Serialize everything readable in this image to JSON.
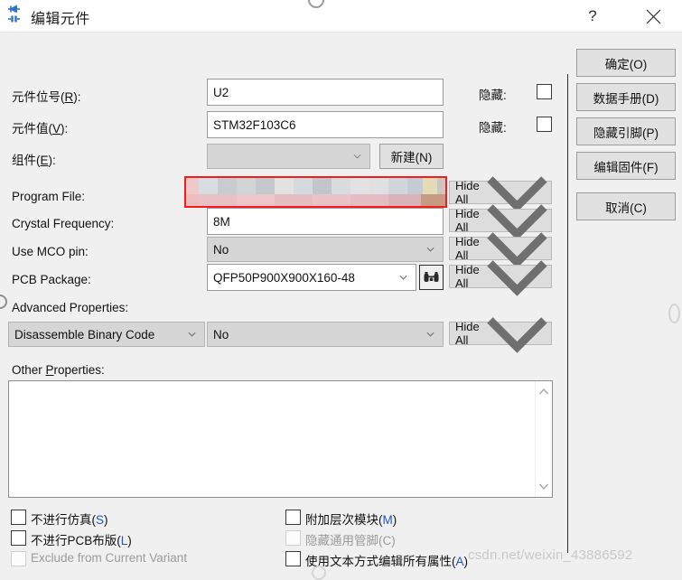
{
  "window": {
    "title": "编辑元件",
    "icon": "component-icon",
    "help_label": "?",
    "close_label": "✕"
  },
  "form": {
    "rows": [
      {
        "label_html": "元件位号(<u>R</u>):",
        "value": "U2",
        "kind": "text"
      },
      {
        "label_html": "元件值(<u>V</u>):",
        "value": "STM32F103C6",
        "kind": "text"
      },
      {
        "label_html": "组件(<u>E</u>):",
        "value": "",
        "kind": "combo-disabled"
      },
      {
        "label_html": "Program File:",
        "value": "",
        "kind": "redacted"
      },
      {
        "label_html": "Crystal Frequency:",
        "value": "8M",
        "kind": "text"
      },
      {
        "label_html": "Use MCO pin:",
        "value": "No",
        "kind": "combo"
      },
      {
        "label_html": "PCB Package:",
        "value": "QFP50P900X900X160-48",
        "kind": "combo-browse"
      }
    ],
    "new_button": "新建(N)",
    "browse_icon": "binoculars-icon",
    "hidden_label": "隐藏:",
    "hide_all_label": "Hide All",
    "hide_all_count": 5
  },
  "advanced": {
    "label": "Advanced Properties:",
    "property": "Disassemble Binary Code",
    "value": "No",
    "visibility": "Hide All"
  },
  "other_properties": {
    "label_html": "Other <u>P</u>roperties:",
    "value": "",
    "scroll_up": "^",
    "scroll_down": "v"
  },
  "checkboxes": {
    "left": [
      {
        "label_html": "不进行仿真(<span class='mn'>S</span>)",
        "checked": false,
        "disabled": false
      },
      {
        "label_html": "不进行PCB布版(<span class='mn'>L</span>)",
        "checked": false,
        "disabled": false
      },
      {
        "label_html": "Exclude from Current Variant",
        "checked": false,
        "disabled": true
      }
    ],
    "right": [
      {
        "label_html": "附加层次模块(<span class='mn'>M</span>)",
        "checked": false,
        "disabled": false
      },
      {
        "label_html": "隐藏通用管脚(<span class='mn'>C</span>)",
        "checked": false,
        "disabled": true
      },
      {
        "label_html": "使用文本方式编辑所有属性(<span class='mn'>A</span>)",
        "checked": false,
        "disabled": false
      }
    ]
  },
  "actions": [
    {
      "label": "确定(O)",
      "name": "ok-button"
    },
    {
      "label": "数据手册(D)",
      "name": "datasheet-button"
    },
    {
      "label": "隐藏引脚(P)",
      "name": "hide-pins-button"
    },
    {
      "label": "编辑固件(F)",
      "name": "edit-firmware-button"
    },
    {
      "label": "取消(C)",
      "name": "cancel-button"
    }
  ],
  "watermark": "csdn.net/weixin_43886592",
  "colors": {
    "dialog_bg": "#f0f0f0",
    "titlebar_bg": "#ffffff",
    "field_bg": "#ffffff",
    "combo_bg": "#d6d6d6",
    "button_bg": "#e1e1e1",
    "border": "#9b9b9b",
    "annotation_red": "#f41d1d",
    "accent_blue": "#1a56c4"
  }
}
